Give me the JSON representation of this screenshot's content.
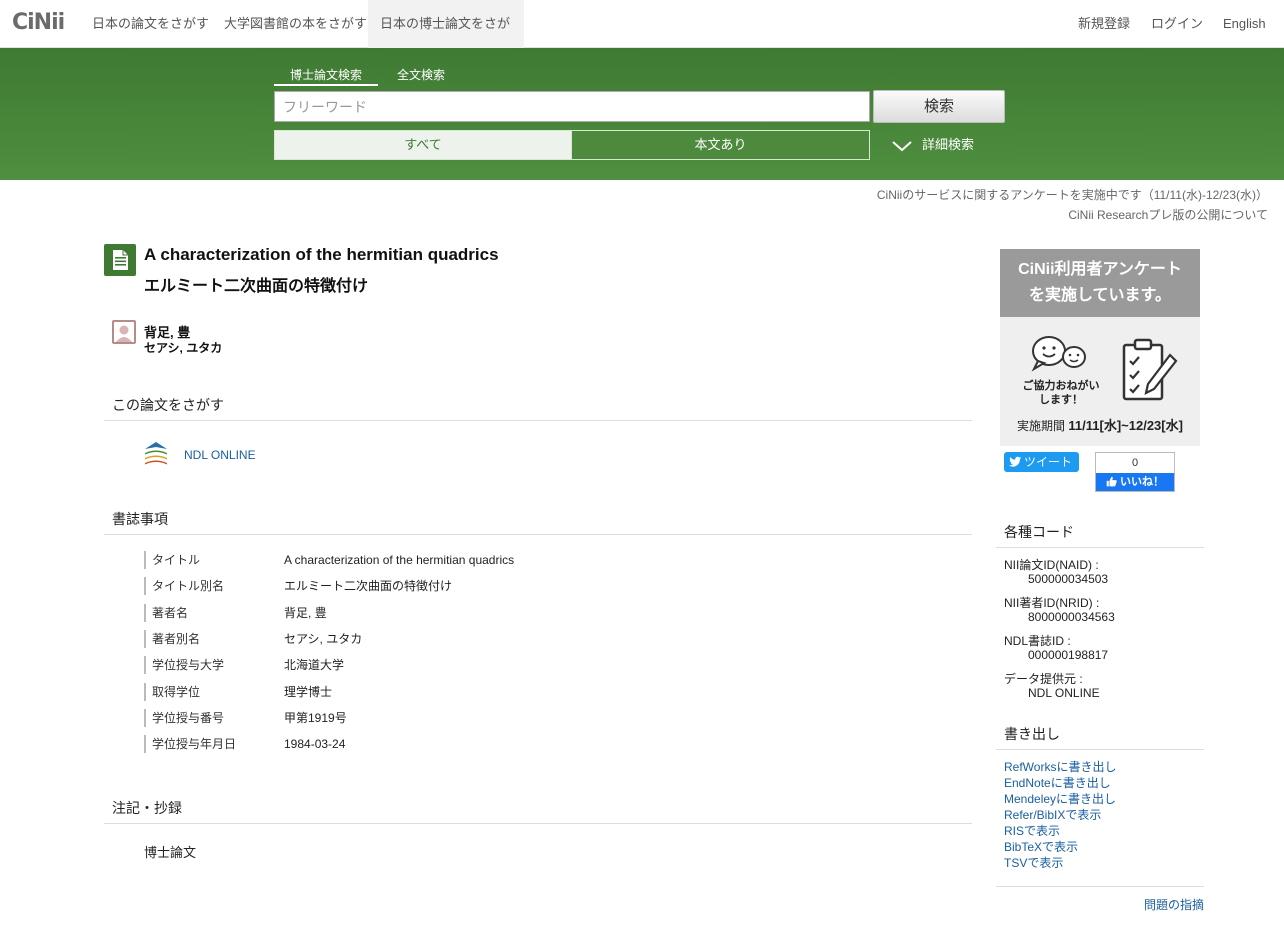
{
  "nav": {
    "logo": "CiNii",
    "items": [
      "日本の論文をさがす",
      "大学図書館の本をさがす",
      "日本の博士論文をさがす"
    ],
    "register": "新規登録",
    "login": "ログイン",
    "language": "English"
  },
  "search": {
    "tabs": [
      "博士論文検索",
      "全文検索"
    ],
    "placeholder": "フリーワード",
    "button": "検索",
    "filter_all": "すべて",
    "filter_fulltext": "本文あり",
    "advanced": "詳細検索"
  },
  "notices": [
    "CiNiiのサービスに関するアンケートを実施中です（11/11(水)-12/23(水)）",
    "CiNii Researchプレ版の公開について"
  ],
  "article": {
    "title_en": "A characterization of the hermitian quadrics",
    "title_ja": "エルミート二次曲面の特徴付け",
    "author": "背足, 豊",
    "author_kana": "セアシ, ユタカ"
  },
  "sections": {
    "search_this": "この論文をさがす",
    "ndl_online": "NDL ONLINE",
    "bibliography": "書誌事項",
    "notes": "注記・抄録",
    "notes_value": "博士論文"
  },
  "biblio": [
    {
      "key": "タイトル",
      "value": "A characterization of the hermitian quadrics"
    },
    {
      "key": "タイトル別名",
      "value": "エルミート二次曲面の特徴付け"
    },
    {
      "key": "著者名",
      "value": "背足, 豊"
    },
    {
      "key": "著者別名",
      "value": "セアシ, ユタカ"
    },
    {
      "key": "学位授与大学",
      "value": "北海道大学"
    },
    {
      "key": "取得学位",
      "value": "理学博士"
    },
    {
      "key": "学位授与番号",
      "value": "甲第1919号"
    },
    {
      "key": "学位授与年月日",
      "value": "1984-03-24"
    }
  ],
  "sidebar": {
    "banner_line1": "CiNii利用者アンケート",
    "banner_line2": "を実施しています。",
    "banner_bubble": "ご協力おねがい",
    "banner_bubble2": "します！",
    "banner_period_label": "実施期間",
    "banner_period": "11/11[水]~12/23[水]",
    "tweet": "ツイート",
    "like_count": "0",
    "like": "いいね！",
    "codes_heading": "各種コード",
    "codes": [
      {
        "key": "NII論文ID(NAID) :",
        "value": "500000034503"
      },
      {
        "key": "NII著者ID(NRID) :",
        "value": "8000000034563"
      },
      {
        "key": "NDL書誌ID :",
        "value": "000000198817"
      },
      {
        "key": "データ提供元 :",
        "value": "NDL ONLINE"
      }
    ],
    "export_heading": "書き出し",
    "exports": [
      "RefWorksに書き出し",
      "EndNoteに書き出し",
      "Mendeleyに書き出し",
      "Refer/BibIXで表示",
      "RISで表示",
      "BibTeXで表示",
      "TSVで表示"
    ],
    "report": "問題の指摘"
  },
  "colors": {
    "brand_green": "#3f7a33",
    "link": "#1a5fa0"
  }
}
